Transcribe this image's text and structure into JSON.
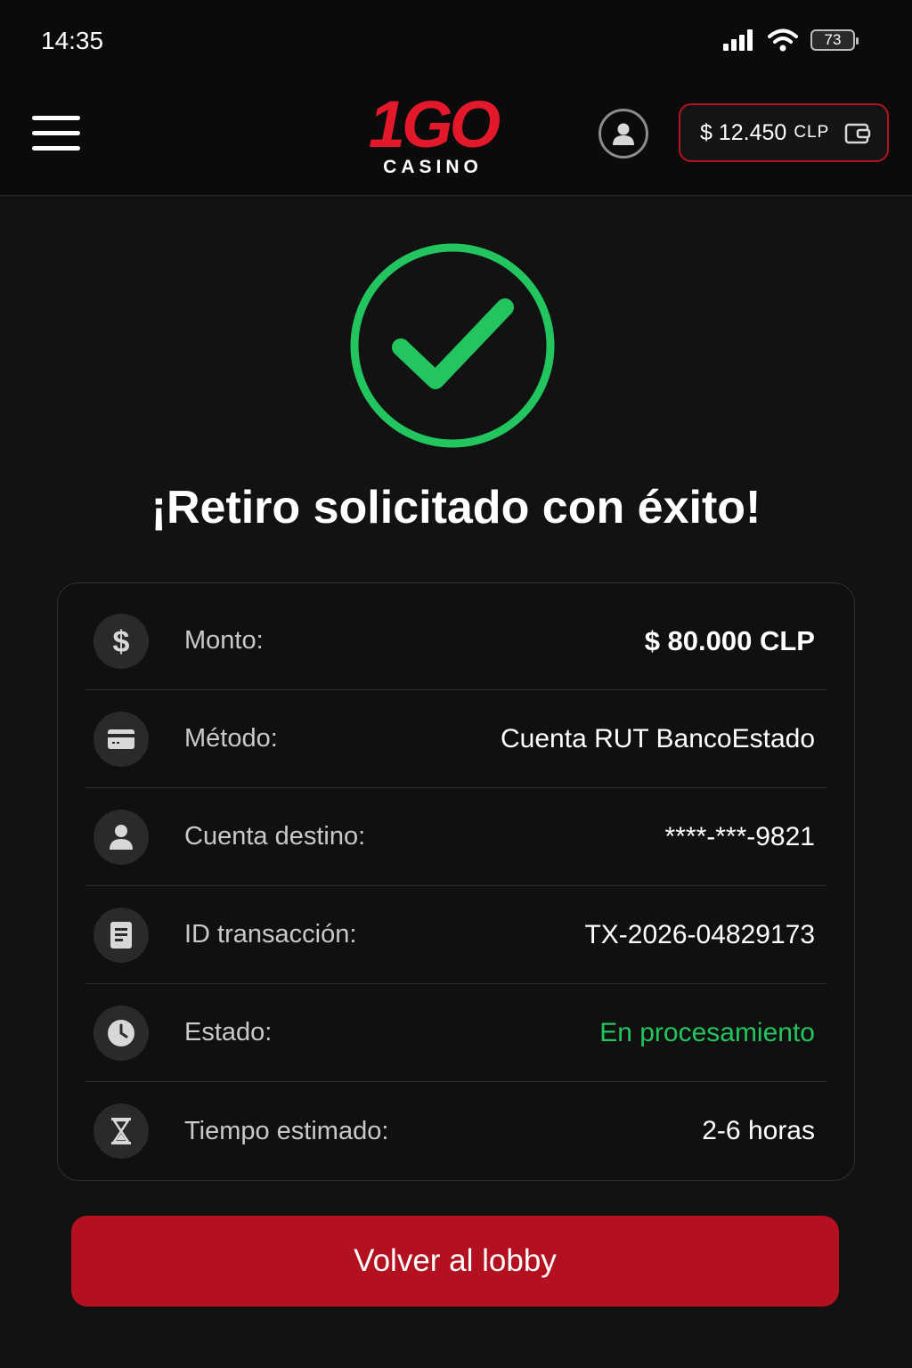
{
  "status_bar": {
    "time": "14:35",
    "battery": "73"
  },
  "header": {
    "logo_main": "1GO",
    "logo_sub": "CASINO",
    "balance_amount": "$ 12.450",
    "balance_currency": "CLP"
  },
  "colors": {
    "accent_red": "#e3192b",
    "button_red": "#b3111f",
    "success_green": "#22c55e",
    "background": "#121212"
  },
  "success": {
    "title": "¡Retiro solicitado con éxito!"
  },
  "details": {
    "rows": [
      {
        "icon": "dollar-icon",
        "label": "Monto:",
        "value": "$ 80.000 CLP"
      },
      {
        "icon": "card-icon",
        "label": "Método:",
        "value": "Cuenta RUT BancoEstado"
      },
      {
        "icon": "user-icon",
        "label": "Cuenta destino:",
        "value": "****-***-9821"
      },
      {
        "icon": "document-icon",
        "label": "ID transacción:",
        "value": "TX-2026-04829173"
      },
      {
        "icon": "clock-icon",
        "label": "Estado:",
        "value": "En procesamiento"
      },
      {
        "icon": "hourglass-icon",
        "label": "Tiempo estimado:",
        "value": "2-6 horas"
      }
    ]
  },
  "actions": {
    "lobby_label": "Volver al lobby"
  }
}
